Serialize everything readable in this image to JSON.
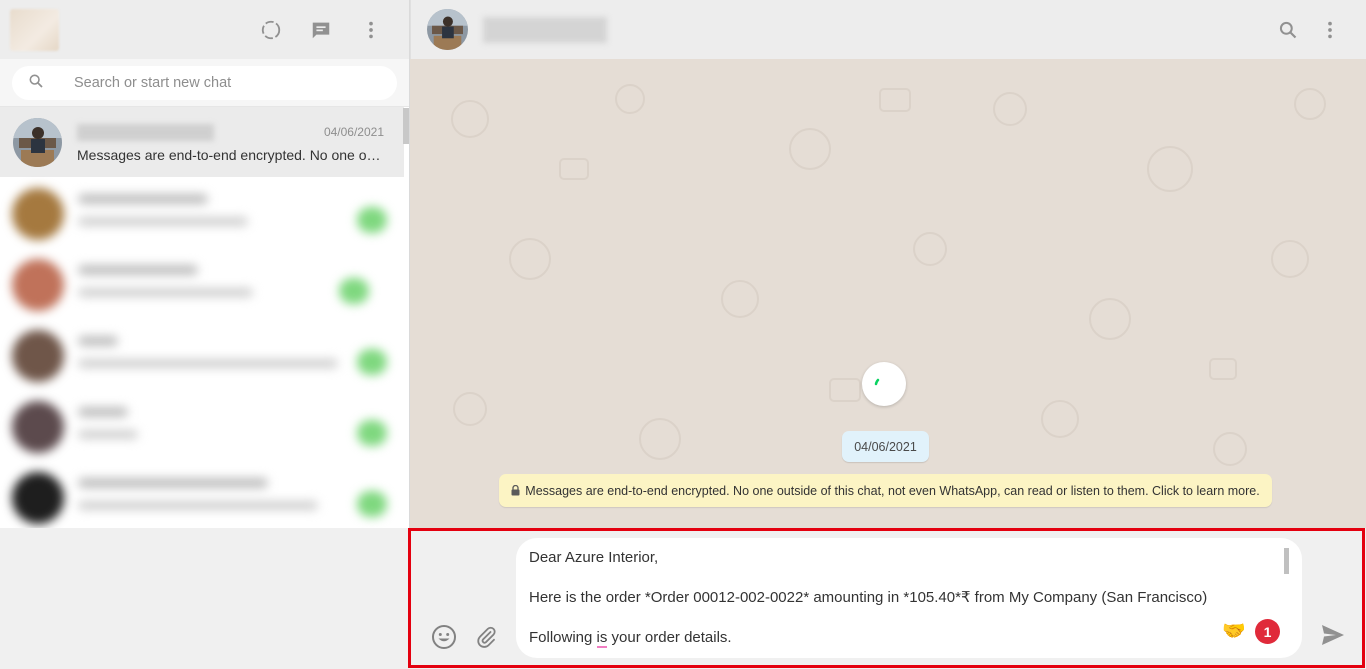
{
  "left": {
    "search": {
      "placeholder": "Search or start new chat"
    },
    "active_chat": {
      "date": "04/06/2021",
      "preview": "Messages are end-to-end encrypted. No one outside of this chat, not even WhatsApp, can read or listen to them."
    }
  },
  "conversation": {
    "date_divider": "04/06/2021",
    "encryption_notice": "Messages are end-to-end encrypted. No one outside of this chat, not even WhatsApp, can read or listen to them. Click to learn more."
  },
  "composer": {
    "lines": {
      "greeting": "Dear Azure Interior,",
      "order": "Here is the order *Order 00012-002-0022* amounting in *105.40*₹ from My Company (San Francisco)",
      "details_prefix": "Following ",
      "details_word": "is",
      "details_suffix": " your order details."
    },
    "extension_badge": "1",
    "extension_emoji": "🤝"
  },
  "icons": {
    "status": "status-icon",
    "new_chat": "new-chat-icon",
    "menu": "menu-icon",
    "search": "search-icon",
    "emoji": "emoji-icon",
    "attach": "attach-icon",
    "send": "send-icon",
    "lock": "lock-icon"
  },
  "colors": {
    "highlight_border": "#e4000f",
    "encryption_bg": "#fcf4c4",
    "date_bg": "#e1f2fb",
    "badge": "#e02a3a"
  }
}
